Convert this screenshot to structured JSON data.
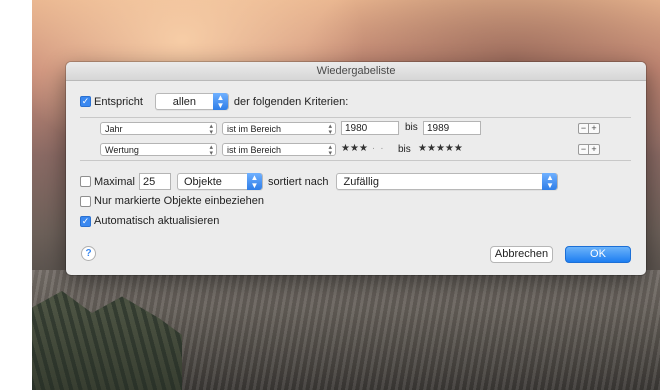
{
  "dialog": {
    "title": "Wiedergabeliste",
    "match": {
      "label_before": "Entspricht",
      "selected": "allen",
      "label_after": "der folgenden Kriterien:",
      "checked": true
    },
    "rules": [
      {
        "field": "Jahr",
        "operator": "ist im Bereich",
        "from_value": "1980",
        "between_label": "bis",
        "to_value": "1989"
      },
      {
        "field": "Wertung",
        "operator": "ist im Bereich",
        "from_stars": 3,
        "between_label": "bis",
        "to_stars": 5
      }
    ],
    "limit": {
      "label": "Maximal",
      "value": "25",
      "unit": "Objekte",
      "sort_label": "sortiert nach",
      "sort_value": "Zufällig",
      "checked": false
    },
    "only_checked": {
      "label": "Nur markierte Objekte einbeziehen",
      "checked": false
    },
    "live_update": {
      "label": "Automatisch aktualisieren",
      "checked": true
    },
    "help_symbol": "?",
    "buttons": {
      "cancel": "Abbrechen",
      "ok": "OK"
    },
    "rule_buttons": {
      "remove": "−",
      "add": "+"
    }
  },
  "icons": {
    "checkmark": "✓",
    "star_filled": "★",
    "star_empty": "·"
  },
  "colors": {
    "accent": "#3a88f0",
    "dialog_bg": "#ececec"
  }
}
